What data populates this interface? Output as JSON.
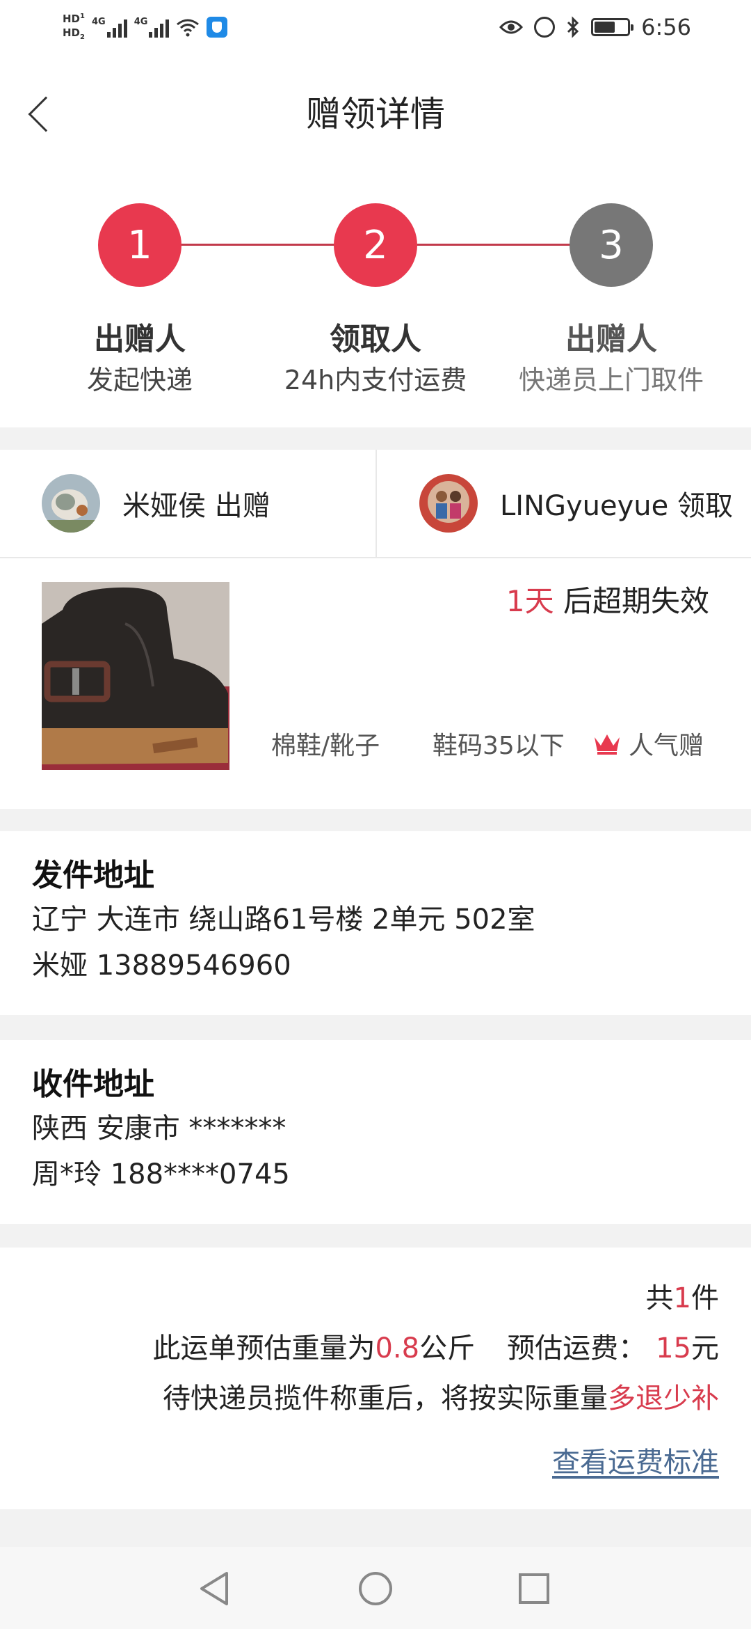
{
  "status_bar": {
    "left_labels": [
      "HD",
      "1",
      "HD",
      "2",
      "4G",
      "4G"
    ],
    "time": "6:56",
    "battery_level": 0.62
  },
  "header": {
    "title": "赠领详情"
  },
  "steps": [
    {
      "number": "1",
      "role": "出赠人",
      "desc": "发起快递",
      "color": "#e8394f"
    },
    {
      "number": "2",
      "role": "领取人",
      "desc": "24h内支付运费",
      "color": "#e8394f"
    },
    {
      "number": "3",
      "role": "出赠人",
      "desc": "快递员上门取件",
      "color": "#777777"
    }
  ],
  "giver": {
    "label": "米娅侯 出赠"
  },
  "receiver": {
    "label": "LINGyueyue 领取"
  },
  "item": {
    "expire_days": "1天",
    "expire_suffix": " 后超期失效",
    "category": "棉鞋/靴子",
    "size": "鞋码35以下",
    "badge": "人气赠"
  },
  "sender_address": {
    "title": "发件地址",
    "line1": "辽宁 大连市 绕山路61号楼 2单元 502室",
    "line2": "米娅 13889546960"
  },
  "receiver_address": {
    "title": "收件地址",
    "line1": "陕西 安康市 *******",
    "line2": "周*玲 188****0745"
  },
  "freight": {
    "count_prefix": "共",
    "count": "1",
    "count_suffix": "件",
    "weight_prefix": "此运单预估重量为",
    "weight": "0.8",
    "weight_unit": "公斤",
    "fee_label": "预估运费：",
    "fee": "15",
    "fee_unit": "元",
    "note_prefix": "待快递员揽件称重后，将按实际重量",
    "note_highlight": "多退少补",
    "link": "查看运费标准"
  },
  "colors": {
    "accent": "#e8394f",
    "accent_text": "#d83b4d",
    "link": "#4a6a92",
    "inactive_step": "#777777"
  }
}
